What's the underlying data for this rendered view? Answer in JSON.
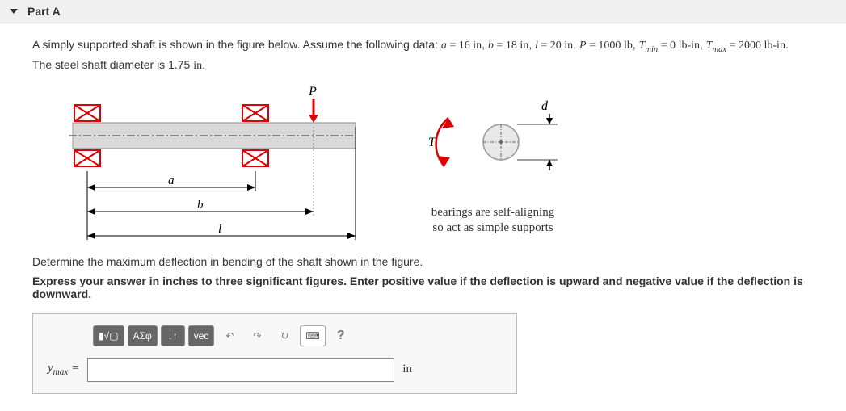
{
  "header": {
    "title": "Part A"
  },
  "problem": {
    "intro": "A simply supported shaft is shown in the figure below. Assume the following data: ",
    "vars": {
      "a_label": "a",
      "a_eq": " = 16 ",
      "a_unit": "in",
      "b_label": "b",
      "b_eq": " = 18 ",
      "b_unit": "in",
      "l_label": "l",
      "l_eq": " = 20 ",
      "l_unit": "in",
      "P_label": "P",
      "P_eq": " = 1000 ",
      "P_unit": "lb",
      "Tmin_lbl": "T",
      "Tmin_sub": "min",
      "Tmin_eq": " = 0 ",
      "Tmin_unit": "lb-in",
      "Tmax_lbl": "T",
      "Tmax_sub": "max",
      "Tmax_eq": " = 2000 ",
      "Tmax_unit": "lb-in"
    },
    "line2": "The steel shaft diameter is 1.75 ",
    "line2_unit": "in",
    "line2_end": "."
  },
  "figure": {
    "P": "P",
    "a": "a",
    "b": "b",
    "l": "l",
    "T": "T",
    "d": "d",
    "caption1": "bearings are self-aligning",
    "caption2": "so act as simple supports"
  },
  "question": "Determine the maximum deflection in bending of the shaft shown in the figure.",
  "instruction": "Express your answer in inches to three significant figures. Enter positive value if the deflection is upward and negative value if the deflection is downward.",
  "toolbar": {
    "templates": "▮√▢",
    "greek": "ΑΣφ",
    "subscript": "↓↑",
    "vec": "vec",
    "undo": "↶",
    "redo": "↷",
    "reset": "↻",
    "keyboard": "⌨",
    "help": "?"
  },
  "answer": {
    "var": "y",
    "sub": "max",
    "eq": " = ",
    "value": "",
    "unit": "in"
  }
}
